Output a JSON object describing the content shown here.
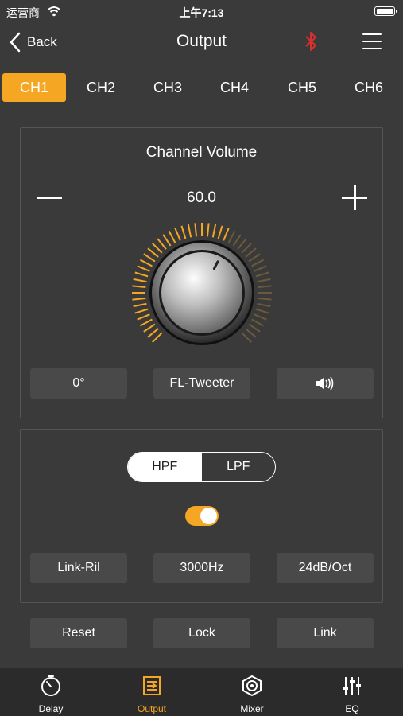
{
  "status_bar": {
    "carrier": "运营商",
    "time": "上午7:13"
  },
  "nav": {
    "back_label": "Back",
    "title": "Output"
  },
  "channels": [
    "CH1",
    "CH2",
    "CH3",
    "CH4",
    "CH5",
    "CH6"
  ],
  "active_channel": "CH1",
  "volume": {
    "title": "Channel Volume",
    "value": "60.0",
    "knob_level_fraction": 0.6
  },
  "channel_controls": {
    "phase": "0°",
    "speaker_name": "FL-Tweeter",
    "mute_icon": "speaker-volume-icon"
  },
  "filter": {
    "tabs": [
      "HPF",
      "LPF"
    ],
    "active_tab": "HPF",
    "enabled": true,
    "type": "Link-Ril",
    "frequency": "3000Hz",
    "slope": "24dB/Oct"
  },
  "actions": {
    "reset": "Reset",
    "lock": "Lock",
    "link": "Link"
  },
  "bottom_tabs": [
    {
      "label": "Delay",
      "icon": "timer-icon"
    },
    {
      "label": "Output",
      "icon": "output-icon"
    },
    {
      "label": "Mixer",
      "icon": "mixer-icon"
    },
    {
      "label": "EQ",
      "icon": "eq-sliders-icon"
    }
  ],
  "active_bottom_tab": "Output",
  "colors": {
    "accent": "#f5a623",
    "bluetooth": "#d9302c",
    "background": "#3a3a3a",
    "tabbar": "#2b2b2b"
  }
}
